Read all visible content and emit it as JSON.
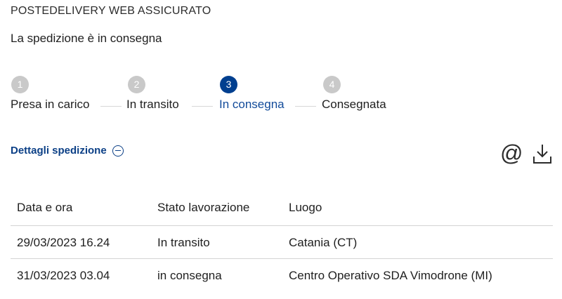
{
  "service": {
    "title": "POSTEDELIVERY WEB ASSICURATO"
  },
  "shipment": {
    "status_text": "La spedizione è in consegna"
  },
  "stepper": {
    "steps": [
      {
        "number": "1",
        "label": "Presa in carico",
        "active": false
      },
      {
        "number": "2",
        "label": "In transito",
        "active": false
      },
      {
        "number": "3",
        "label": "In consegna",
        "active": true
      },
      {
        "number": "4",
        "label": "Consegnata",
        "active": false
      }
    ]
  },
  "details": {
    "toggle_label": "Dettagli spedizione",
    "toggle_icon": "minus-circle-icon",
    "actions": [
      {
        "icon": "at-sign-icon",
        "glyph": "@"
      },
      {
        "icon": "download-icon"
      }
    ]
  },
  "table": {
    "headers": [
      "Data e ora",
      "Stato lavorazione",
      "Luogo"
    ],
    "rows": [
      [
        "29/03/2023 16.24",
        "In transito",
        "Catania (CT)"
      ],
      [
        "31/03/2023 03.04",
        "in consegna",
        "Centro Operativo SDA Vimodrone (MI)"
      ]
    ]
  },
  "colors": {
    "accent": "#003f8f",
    "link": "#0b3f86",
    "inactive_step": "#c9c9c9",
    "divider": "#d4d4d4"
  }
}
